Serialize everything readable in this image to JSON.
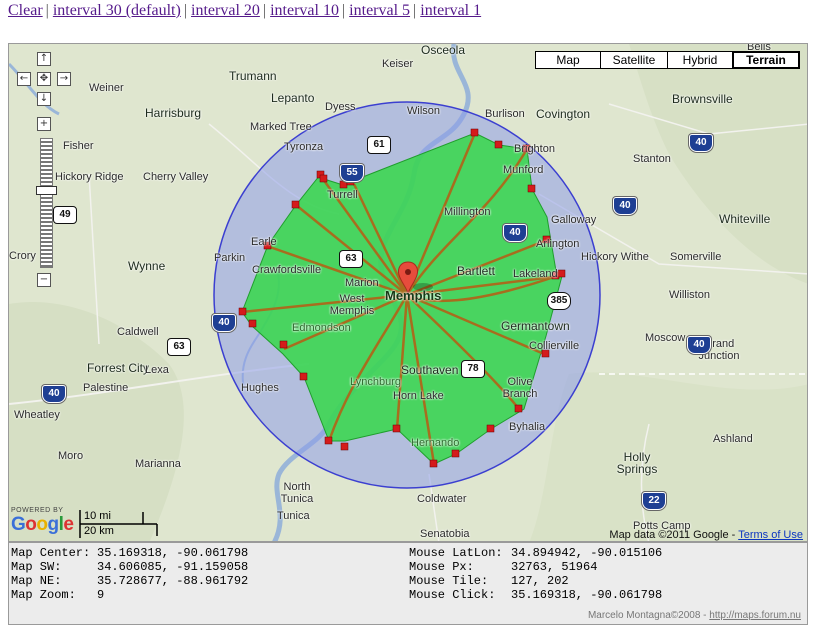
{
  "links": {
    "clear": "Clear",
    "interval_30": "interval 30 (default)",
    "interval_20": "interval 20",
    "interval_10": "interval 10",
    "interval_5": "interval 5",
    "interval_1": "interval 1",
    "separator": "|"
  },
  "map_type": {
    "map": "Map",
    "satellite": "Satellite",
    "hybrid": "Hybrid",
    "terrain": "Terrain",
    "selected": "Terrain"
  },
  "controls": {
    "pan_up": "↑",
    "pan_left": "←",
    "pan_center": "✥",
    "pan_right": "→",
    "pan_down": "↓",
    "zoom_in": "+",
    "zoom_out": "−"
  },
  "colors": {
    "circle_fill": "#8e9ce9",
    "circle_stroke": "#3b3fd0",
    "area_fill": "#36d84a",
    "area_stroke": "#1f9e2c",
    "road": "#a86d1e",
    "vertex": "#d41b1b",
    "marker": "#e74c3c",
    "water": "#9ab6d8"
  },
  "places": {
    "osceola": "Osceola",
    "keiser": "Keiser",
    "trumann": "Trumann",
    "weiner": "Weiner",
    "lepanto": "Lepanto",
    "dyess": "Dyess",
    "wilson": "Wilson",
    "burlison": "Burlison",
    "covington": "Covington",
    "brownsville": "Brownsville",
    "harrisburg": "Harrisburg",
    "marked_tree": "Marked Tree",
    "tyronza": "Tyronza",
    "brighton": "Brighton",
    "fisher": "Fisher",
    "munford": "Munford",
    "stanton": "Stanton",
    "hickory_ridge": "Hickory Ridge",
    "cherry_valley": "Cherry Valley",
    "turrell": "Turrell",
    "millington": "Millington",
    "galloway": "Galloway",
    "whiteville": "Whiteville",
    "earle": "Earle",
    "arlington": "Arlington",
    "hickory_withe": "Hickory Withe",
    "crory": "Crory",
    "wynne": "Wynne",
    "parkin": "Parkin",
    "crawfordsville": "Crawfordsville",
    "bartlett": "Bartlett",
    "lakeland": "Lakeland",
    "somerville": "Somerville",
    "marion": "Marion",
    "memphis": "Memphis",
    "west_memphis": "West Memphis",
    "williston": "Williston",
    "edmondson": "Edmondson",
    "germantown": "Germantown",
    "caldwell": "Caldwell",
    "moscow": "Moscow",
    "collierville": "Collierville",
    "grand_junction": "Grand Junction",
    "forrest_city": "Forrest City",
    "southaven": "Southaven",
    "lynchburg": "Lynchburg",
    "olive_branch": "Olive Branch",
    "palestine": "Palestine",
    "hughes": "Hughes",
    "horn_lake": "Horn Lake",
    "wheatley": "Wheatley",
    "byhalia": "Byhalia",
    "ashland": "Ashland",
    "hernando": "Hernando",
    "moro": "Moro",
    "marianna": "Marianna",
    "holly_springs": "Holly Springs",
    "coldwater": "Coldwater",
    "north_tunica": "North Tunica",
    "tunica": "Tunica",
    "potts_camp": "Potts Camp",
    "senatobia": "Senatobia",
    "bells": "Bells",
    "lexa": "Lexa"
  },
  "shields": {
    "i40_w": "40",
    "i40_e": "40",
    "i40_sw": "40",
    "i40_ne": "40",
    "i40_mid": "40",
    "i40_ar": "40",
    "us61": "61",
    "i55": "55",
    "us49": "49",
    "us63": "63",
    "us63b": "63",
    "i40c": "40",
    "us78": "78",
    "i22": "22",
    "tn385": "385",
    "i40_east2": "40"
  },
  "google": {
    "powered_by": "POWERED BY",
    "logo": "Google"
  },
  "scale": {
    "miles": "10 mi",
    "km": "20 km"
  },
  "attribution": {
    "text": "Map data ©2011 Google -",
    "terms": "Terms of Use"
  },
  "info": {
    "map_center_label": "Map Center:",
    "map_center": "35.169318, -90.061798",
    "map_sw_label": "Map SW:",
    "map_sw": "34.606085, -91.159058",
    "map_ne_label": "Map NE:",
    "map_ne": "35.728677, -88.961792",
    "map_zoom_label": "Map Zoom:",
    "map_zoom": "9",
    "mouse_latlon_label": "Mouse LatLon:",
    "mouse_latlon": "34.894942, -90.015106",
    "mouse_px_label": "Mouse Px:",
    "mouse_px": "32763, 51964",
    "mouse_tile_label": "Mouse Tile:",
    "mouse_tile": "127, 202",
    "mouse_click_label": "Mouse Click:",
    "mouse_click": "35.169318, -90.061798"
  },
  "credit": {
    "text": "Marcelo Montagna©2008 -",
    "link": "http://maps.forum.nu"
  }
}
